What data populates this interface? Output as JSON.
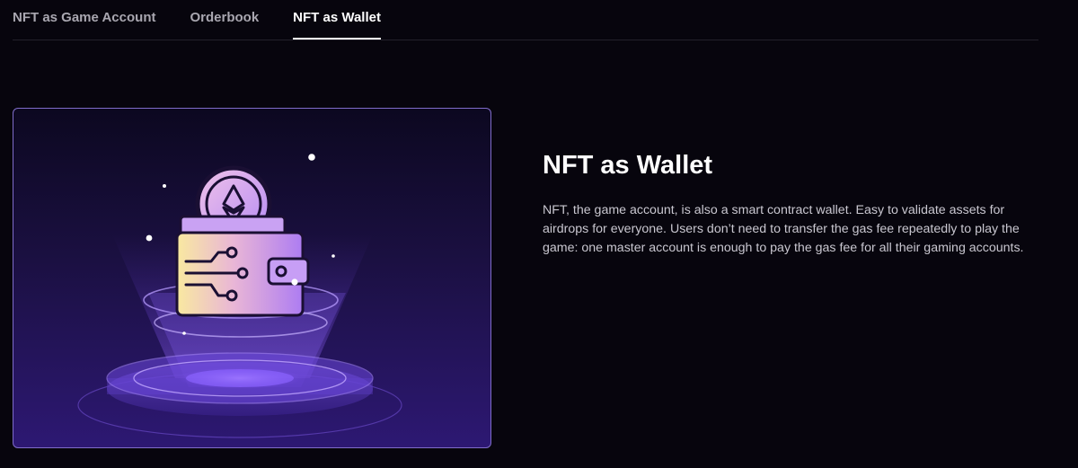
{
  "tabs": [
    {
      "label": "NFT as Game Account",
      "active": false
    },
    {
      "label": "Orderbook",
      "active": false
    },
    {
      "label": "NFT as Wallet",
      "active": true
    }
  ],
  "feature": {
    "title": "NFT as Wallet",
    "description": "NFT, the game account, is also a smart contract wallet. Easy to validate assets for airdrops for everyone. Users don’t need to transfer the gas fee repeatedly to play the game: one master account is enough to pay the gas fee for all their gaming accounts."
  },
  "illustration": {
    "icons": [
      "wallet-icon",
      "ethereum-coin-icon",
      "circuit-lines-icon",
      "pedestal-rings"
    ],
    "colors": {
      "accent": "#7f6cc9",
      "wallet_start": "#f8e7a3",
      "wallet_end": "#b07cf0",
      "beam": "#8a5cf0"
    }
  }
}
